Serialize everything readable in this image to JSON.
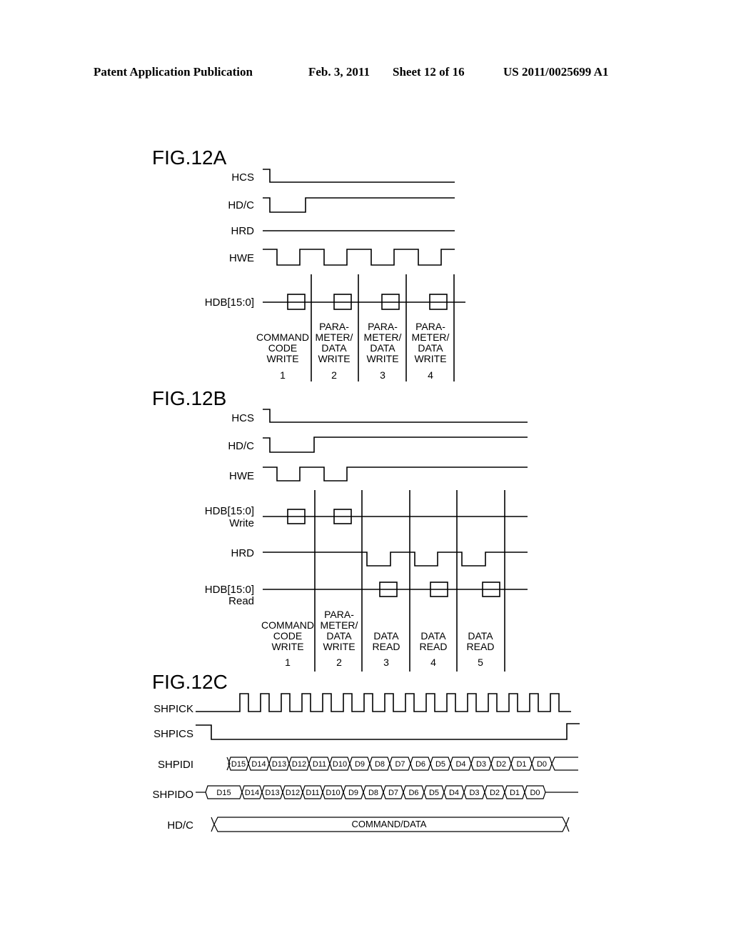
{
  "header": {
    "publication": "Patent Application Publication",
    "date": "Feb. 3, 2011",
    "sheet": "Sheet 12 of 16",
    "number": "US 2011/0025699 A1"
  },
  "fig12a": {
    "title": "FIG.12A",
    "signals": [
      "HCS",
      "HD/C",
      "HRD",
      "HWE",
      "HDB[15:0]"
    ],
    "phases": [
      {
        "lines": [
          "COMMAND",
          "CODE",
          "WRITE"
        ],
        "num": "1"
      },
      {
        "lines": [
          "PARA-",
          "METER/",
          "DATA",
          "WRITE"
        ],
        "num": "2"
      },
      {
        "lines": [
          "PARA-",
          "METER/",
          "DATA",
          "WRITE"
        ],
        "num": "3"
      },
      {
        "lines": [
          "PARA-",
          "METER/",
          "DATA",
          "WRITE"
        ],
        "num": "4"
      }
    ]
  },
  "fig12b": {
    "title": "FIG.12B",
    "signals": [
      "HCS",
      "HD/C",
      "HWE",
      "HDB[15:0]",
      "Write",
      "HRD",
      "HDB[15:0]",
      "Read"
    ],
    "phases": [
      {
        "lines": [
          "COMMAND",
          "CODE",
          "WRITE"
        ],
        "num": "1"
      },
      {
        "lines": [
          "PARA-",
          "METER/",
          "DATA",
          "WRITE"
        ],
        "num": "2"
      },
      {
        "lines": [
          "DATA",
          "READ"
        ],
        "num": "3"
      },
      {
        "lines": [
          "DATA",
          "READ"
        ],
        "num": "4"
      },
      {
        "lines": [
          "DATA",
          "READ"
        ],
        "num": "5"
      }
    ]
  },
  "fig12c": {
    "title": "FIG.12C",
    "signals": [
      "SHPICK",
      "SHPICS",
      "SHPIDI",
      "SHPIDO",
      "HD/C"
    ],
    "bits": [
      "D15",
      "D14",
      "D13",
      "D12",
      "D11",
      "D10",
      "D9",
      "D8",
      "D7",
      "D6",
      "D5",
      "D4",
      "D3",
      "D2",
      "D1",
      "D0"
    ],
    "hdc_label": "COMMAND/DATA"
  }
}
